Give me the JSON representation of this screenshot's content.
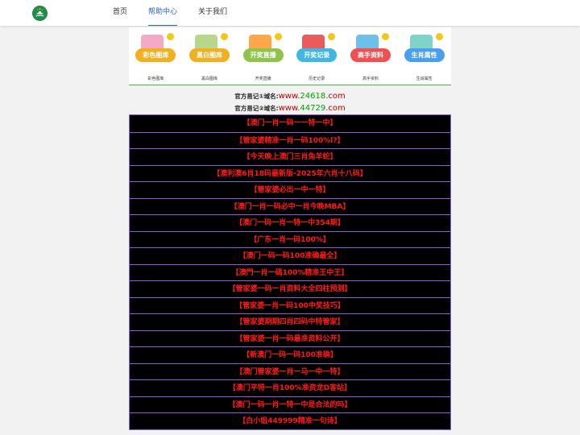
{
  "nav": {
    "items": [
      {
        "label": "首页",
        "active": false
      },
      {
        "label": "帮助中心",
        "active": true
      },
      {
        "label": "关于我们",
        "active": false
      }
    ]
  },
  "icons": [
    {
      "badge": "彩色图库",
      "label": "彩色图库",
      "icon": "color-gallery-icon",
      "bg": "#f4a9c4",
      "badge_color": "#f0b020"
    },
    {
      "badge": "黑白图库",
      "label": "黑白图库",
      "icon": "bw-gallery-icon",
      "bg": "#b7d88a",
      "badge_color": "#f0b020"
    },
    {
      "badge": "开奖直播",
      "label": "开奖直播",
      "icon": "live-draw-icon",
      "bg": "#ffa54a",
      "badge_color": "#8fc34a"
    },
    {
      "badge": "开奖记录",
      "label": "历史记录",
      "icon": "draw-history-icon",
      "bg": "#e85c5c",
      "badge_color": "#41b7e0"
    },
    {
      "badge": "高手资料",
      "label": "高手资料",
      "icon": "expert-info-icon",
      "bg": "#6fc0e8",
      "badge_color": "#f05050"
    },
    {
      "badge": "生肖属性",
      "label": "生肖属性",
      "icon": "zodiac-icon",
      "bg": "#7fd3c8",
      "badge_color": "#4a9ef0"
    }
  ],
  "domains": [
    {
      "prefix": "官方易记①域名:",
      "url_a": "www.",
      "url_b": "24618",
      "url_c": ".com"
    },
    {
      "prefix": "官方易记②域名:",
      "url_a": "www.",
      "url_b": "44729",
      "url_c": ".com"
    }
  ],
  "list": [
    "【澳门一肖一码一一特一中】",
    "【管家婆精准一肖一码100%l?】",
    "【今天晚上澳门三肖兔羊蛇】",
    "【澳利澳6肖18码最新版-2025年六肖十八码】",
    "【管家婆必出一中一特】",
    "【澳门一肖一码必中一肖今晚MBA】",
    "【澳门一码一肖一特一中354期】",
    "【广东一肖一码100%】",
    "【澳门一码一码100准确最全】",
    "【澳門一肖一碼100%精准王中王】",
    "【管家婆一码一肖资料大全四柱预测】",
    "【管家婆一肖一码100中奖技巧】",
    "【管家婆期期四肖四码中特管家】",
    "【管家婆一肖一码最准资料公开】",
    "【新澳门一码一码100准确】",
    "【澳门管家婆一肖一马一中一特】",
    "【澳门平特一肖100%准资龙D客站】",
    "【澳门一码一肖一特一中是合法的吗】",
    "【白小姐449999精准一句诗】"
  ]
}
